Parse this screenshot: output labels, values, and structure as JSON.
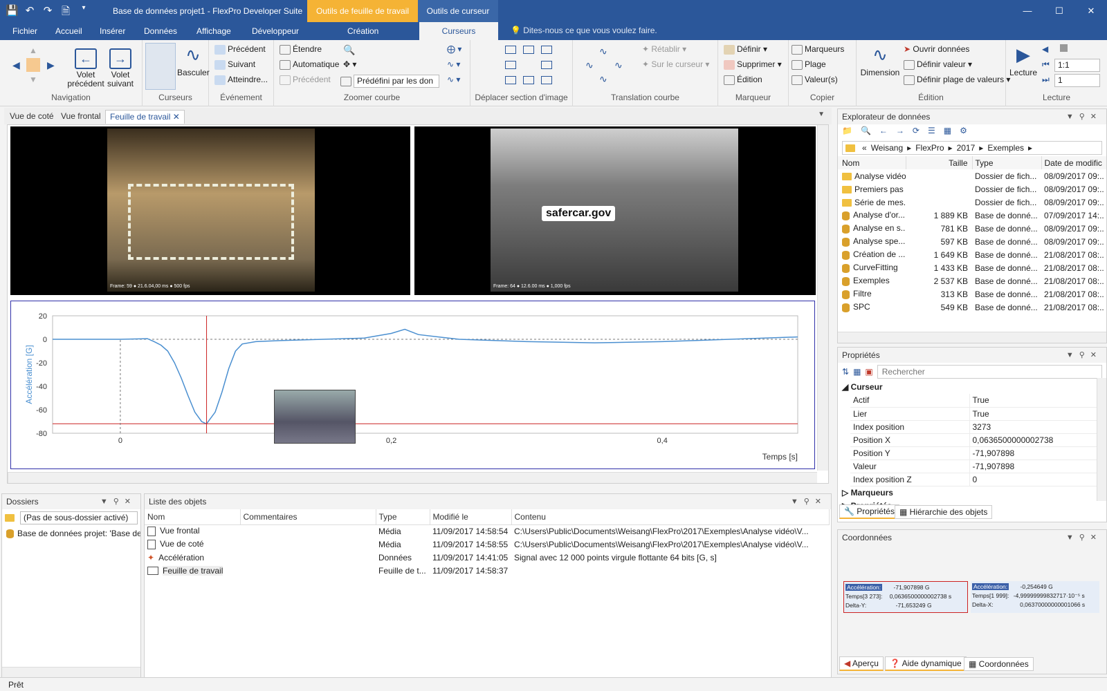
{
  "titlebar": {
    "title": "Base de données projet1 - FlexPro Developer Suite",
    "context_worksheet": "Outils de feuille de travail",
    "context_cursor": "Outils de curseur"
  },
  "tabs": [
    "Fichier",
    "Accueil",
    "Insérer",
    "Données",
    "Affichage",
    "Développeur",
    "Création",
    "Curseurs"
  ],
  "tellme": "Dites-nous ce que vous voulez faire.",
  "ribbon": {
    "navigation": {
      "label": "Navigation",
      "prev": "Volet précédent",
      "next": "Volet suivant"
    },
    "curseurs": {
      "label": "Curseurs",
      "toggle": "Basculer"
    },
    "evenement": {
      "label": "Événement",
      "prev": "Précédent",
      "next": "Suivant",
      "reach": "Atteindre..."
    },
    "zoom": {
      "label": "Zoomer courbe",
      "extend": "Étendre",
      "auto": "Automatique",
      "prev": "Précédent",
      "preset": "Prédéfini par les don"
    },
    "move": {
      "label": "Déplacer section d'image"
    },
    "translate": {
      "label": "Translation courbe",
      "restore": "Rétablir",
      "oncursor": "Sur le curseur"
    },
    "marker": {
      "label": "Marqueur",
      "define": "Définir",
      "delete": "Supprimer",
      "edit": "Édition"
    },
    "copy": {
      "label": "Copier",
      "markers": "Marqueurs",
      "range": "Plage",
      "values": "Valeur(s)"
    },
    "edition": {
      "label": "Édition",
      "dimension": "Dimension",
      "open": "Ouvrir données",
      "setvalue": "Définir valeur",
      "setrange": "Définir plage de valeurs"
    },
    "lecture": {
      "label": "Lecture",
      "play": "Lecture",
      "speed": "1:1",
      "step": "1"
    }
  },
  "doc_tabs": [
    "Vue de coté",
    "Vue frontal",
    "Feuille de travail"
  ],
  "videos": {
    "front_overlay": "Frame: 59  ● 21.6.04,00 ms  ● 500 fps",
    "side_logo": "safercar.gov",
    "side_overlay": "Frame: 64  ● 12.6.00 ms  ● 1,000 fps"
  },
  "chart_data": {
    "type": "line",
    "ylabel": "Accélération [G]",
    "xlabel": "Temps [s]",
    "ylim": [
      -80,
      20
    ],
    "xlim": [
      -0.05,
      0.5
    ],
    "yticks": [
      "20",
      "0",
      "-20",
      "-40",
      "-60",
      "-80"
    ],
    "xticks": [
      "0",
      "0,2",
      "0,4"
    ],
    "cursor_x": 0.06365,
    "cursor_y": -71.907898,
    "series": [
      {
        "x": [
          -0.05,
          0.0,
          0.02,
          0.025,
          0.03,
          0.035,
          0.04,
          0.045,
          0.05,
          0.055,
          0.06,
          0.0636,
          0.07,
          0.075,
          0.08,
          0.085,
          0.09,
          0.1,
          0.12,
          0.15,
          0.18,
          0.2,
          0.21,
          0.22,
          0.25,
          0.3,
          0.35,
          0.4,
          0.45,
          0.5
        ],
        "y": [
          0,
          0,
          0.5,
          -2,
          -5,
          -10,
          -20,
          -33,
          -48,
          -62,
          -70,
          -72,
          -62,
          -45,
          -25,
          -10,
          -4,
          -2,
          -1,
          0,
          1,
          5,
          8.5,
          4,
          0,
          -2,
          -3,
          -2,
          0,
          2
        ]
      }
    ]
  },
  "dossiers": {
    "title": "Dossiers",
    "filter": "(Pas de sous-dossier activé)",
    "item": "Base de données projet: 'Base de d"
  },
  "objects": {
    "title": "Liste des objets",
    "columns": [
      "Nom",
      "Commentaires",
      "Type",
      "Modifié le",
      "Contenu"
    ],
    "rows": [
      {
        "name": "Vue frontal",
        "type": "Média",
        "date": "11/09/2017 14:58:54",
        "content": "C:\\Users\\Public\\Documents\\Weisang\\FlexPro\\2017\\Exemples\\Analyse vidéo\\V..."
      },
      {
        "name": "Vue de coté",
        "type": "Média",
        "date": "11/09/2017 14:58:55",
        "content": "C:\\Users\\Public\\Documents\\Weisang\\FlexPro\\2017\\Exemples\\Analyse vidéo\\V..."
      },
      {
        "name": "Accélération",
        "type": "Données",
        "date": "11/09/2017 14:41:05",
        "content": "Signal avec 12 000 points virgule flottante 64 bits [G, s]"
      },
      {
        "name": "Feuille de travail",
        "type": "Feuille de t...",
        "date": "11/09/2017 14:58:37",
        "content": ""
      }
    ]
  },
  "explorer": {
    "title": "Explorateur de données",
    "path": [
      "«",
      "Weisang",
      "FlexPro",
      "2017",
      "Exemples"
    ],
    "columns": [
      "Nom",
      "Taille",
      "Type",
      "Date de modific"
    ],
    "rows": [
      {
        "name": "Analyse vidéo",
        "size": "",
        "type": "Dossier de fich...",
        "date": "08/09/2017 09:.."
      },
      {
        "name": "Premiers pas",
        "size": "",
        "type": "Dossier de fich...",
        "date": "08/09/2017 09:.."
      },
      {
        "name": "Série de mes...",
        "size": "",
        "type": "Dossier de fich...",
        "date": "08/09/2017 09:.."
      },
      {
        "name": "Analyse d'or...",
        "size": "1 889 KB",
        "type": "Base de donné...",
        "date": "07/09/2017 14:.."
      },
      {
        "name": "Analyse en s...",
        "size": "781 KB",
        "type": "Base de donné...",
        "date": "08/09/2017 09:.."
      },
      {
        "name": "Analyse spe...",
        "size": "597 KB",
        "type": "Base de donné...",
        "date": "08/09/2017 09:.."
      },
      {
        "name": "Création de ...",
        "size": "1 649 KB",
        "type": "Base de donné...",
        "date": "21/08/2017 08:.."
      },
      {
        "name": "CurveFitting",
        "size": "1 433 KB",
        "type": "Base de donné...",
        "date": "21/08/2017 08:.."
      },
      {
        "name": "Exemples",
        "size": "2 537 KB",
        "type": "Base de donné...",
        "date": "21/08/2017 08:.."
      },
      {
        "name": "Filtre",
        "size": "313 KB",
        "type": "Base de donné...",
        "date": "21/08/2017 08:.."
      },
      {
        "name": "SPC",
        "size": "549 KB",
        "type": "Base de donné...",
        "date": "21/08/2017 08:.."
      }
    ]
  },
  "props": {
    "title": "Propriétés",
    "search_placeholder": "Rechercher",
    "category": "Curseur",
    "rows": [
      {
        "k": "Actif",
        "v": "True"
      },
      {
        "k": "Lier",
        "v": "True"
      },
      {
        "k": "Index position",
        "v": "3273"
      },
      {
        "k": "Position X",
        "v": "0,0636500000002738"
      },
      {
        "k": "Position Y",
        "v": "-71,907898"
      },
      {
        "k": "Valeur",
        "v": "-71,907898"
      },
      {
        "k": "Index position Z",
        "v": "0"
      }
    ],
    "category2": "Marqueurs",
    "category3": "Propriétés",
    "tab1": "Propriétés",
    "tab2": "Hiérarchie des objets"
  },
  "coords": {
    "title": "Coordonnées",
    "left": {
      "l1": "Accélération:",
      "v1": "-71,907898 G",
      "l2": "Temps[3 273]:",
      "v2": "0,0636500000002738 s",
      "l3": "Delta-Y:",
      "v3": "-71,653249 G"
    },
    "right": {
      "l1": "Accélération:",
      "v1": "-0,254649 G",
      "l2": "Temps[1 999]:",
      "v2": "-4,99999999832717·10⁻⁵ s",
      "l3": "Delta-X:",
      "v3": "0,06370000000001066 s"
    },
    "tabs": [
      "Aperçu",
      "Aide dynamique",
      "Coordonnées"
    ]
  },
  "status": "Prêt"
}
